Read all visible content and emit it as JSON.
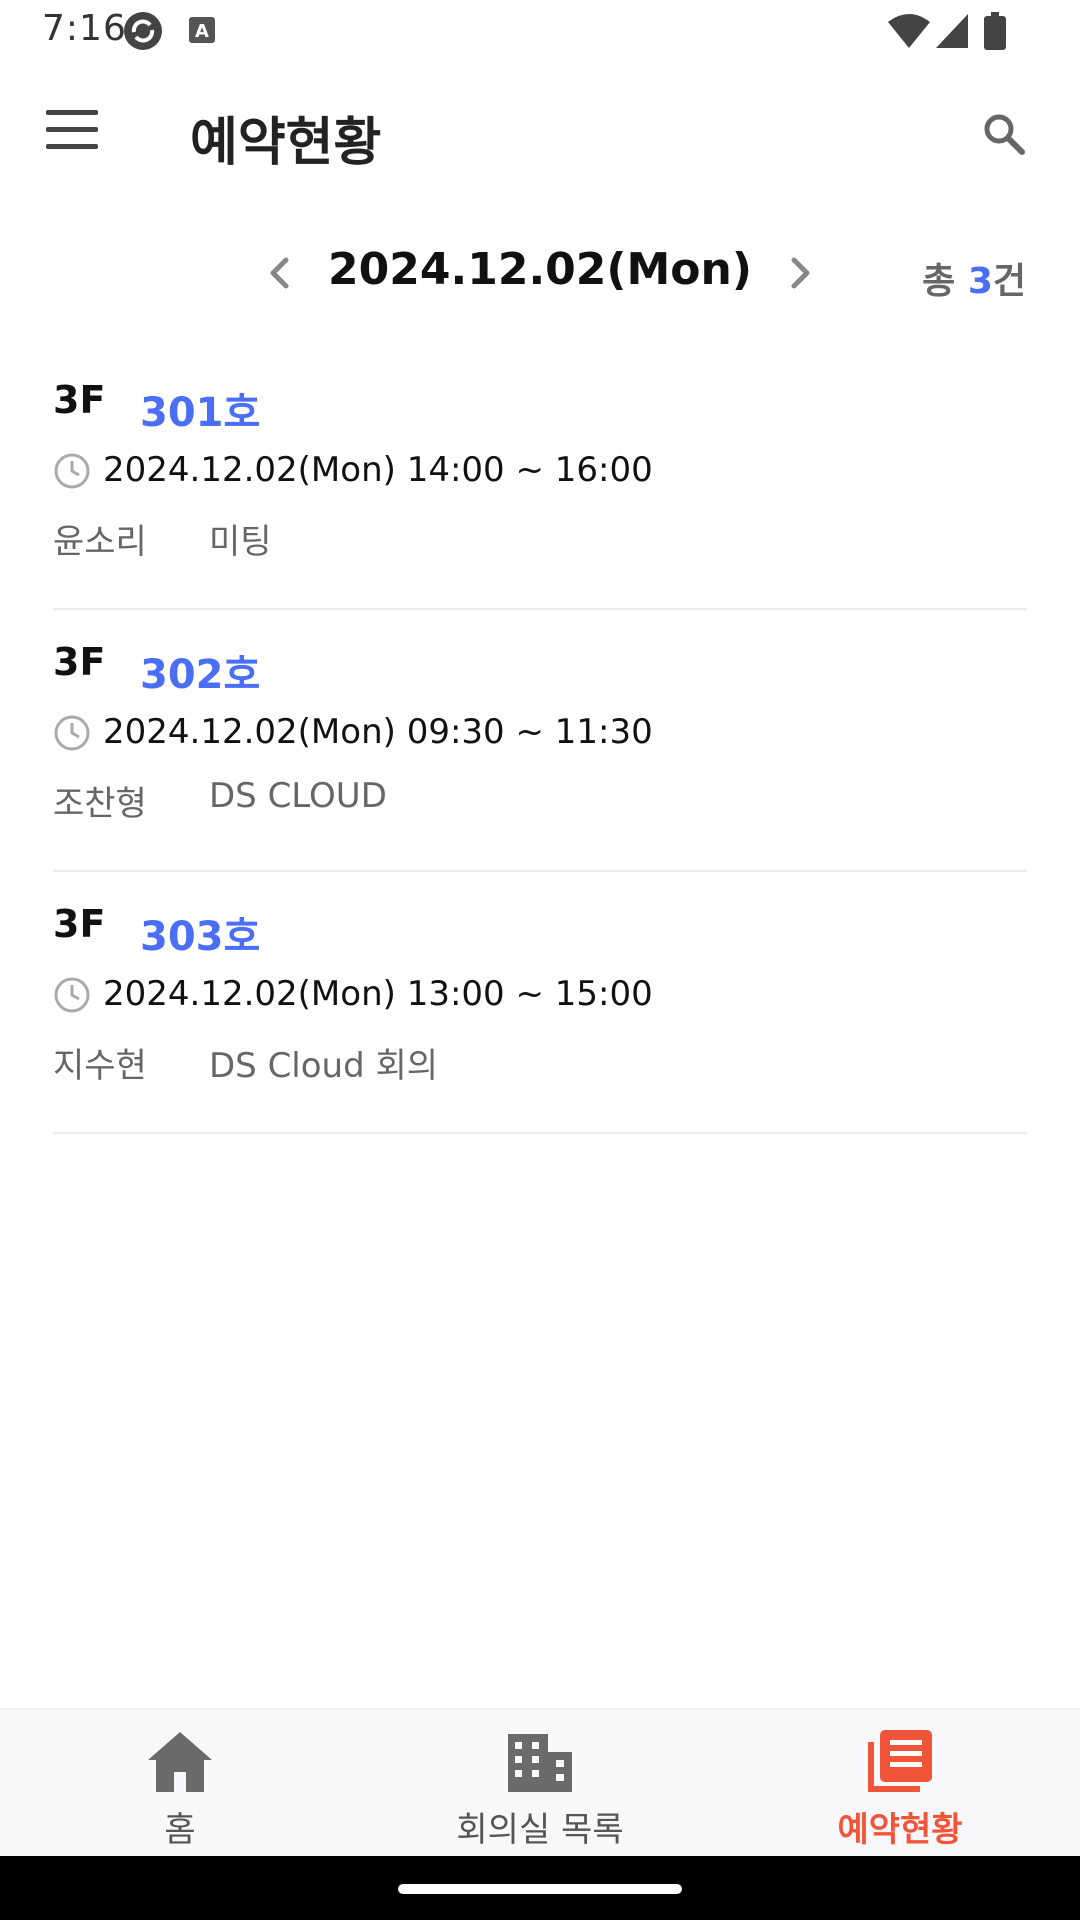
{
  "status_bar": {
    "time": "7:16",
    "icons": [
      "sync-icon",
      "keyboard-a-icon",
      "wifi-icon",
      "signal-icon",
      "battery-icon"
    ]
  },
  "app_bar": {
    "title": "예약현황",
    "menu_icon": "menu-icon",
    "search_icon": "search-icon"
  },
  "date_nav": {
    "date": "2024.12.02(Mon)",
    "total_prefix": "총",
    "total_count": "3",
    "total_suffix": "건"
  },
  "reservations": [
    {
      "floor": "3F",
      "room": "301호",
      "time": "2024.12.02(Mon) 14:00 ~ 16:00",
      "person": "윤소리",
      "purpose": "미팅"
    },
    {
      "floor": "3F",
      "room": "302호",
      "time": "2024.12.02(Mon) 09:30 ~ 11:30",
      "person": "조찬형",
      "purpose": "DS CLOUD"
    },
    {
      "floor": "3F",
      "room": "303호",
      "time": "2024.12.02(Mon) 13:00 ~ 15:00",
      "person": "지수현",
      "purpose": "DS Cloud 회의"
    }
  ],
  "bottom_nav": {
    "tabs": [
      {
        "label": "홈",
        "icon": "home-icon",
        "active": false
      },
      {
        "label": "회의실 목록",
        "icon": "building-icon",
        "active": false
      },
      {
        "label": "예약현황",
        "icon": "reservation-list-icon",
        "active": true
      }
    ]
  },
  "colors": {
    "accent_blue": "#4a6ef5",
    "active_orange": "#f0553a",
    "text_dark": "#111111",
    "text_gray": "#666666"
  }
}
